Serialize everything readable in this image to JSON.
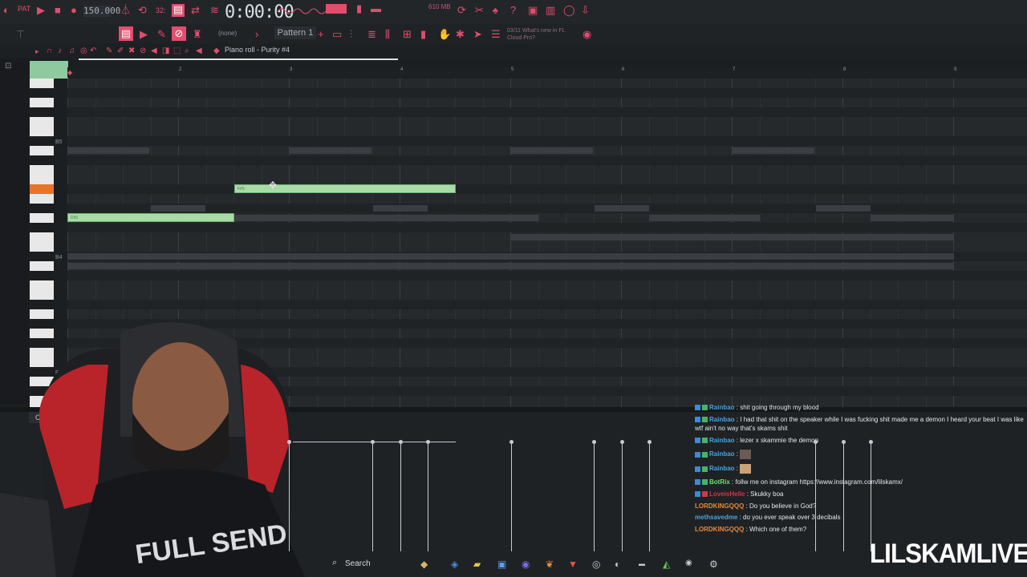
{
  "toolbar": {
    "tempo": "150.000",
    "time": "0:00:00",
    "memory": "610 MB",
    "pattern": "Pattern 1",
    "preset": "(none)",
    "hint_line1": "03/11 What's new in FL",
    "hint_line2": "Cloud Pro?",
    "accent_color": "#e24d6d"
  },
  "piano_roll": {
    "title": "Piano roll - Purity #4",
    "ruler": [
      "2",
      "3",
      "4",
      "5",
      "6",
      "7",
      "8",
      "9"
    ],
    "key_labels": [
      "B5",
      "B4",
      "B3"
    ],
    "notes": [
      {
        "label": "F#5"
      },
      {
        "label": "D#5"
      }
    ]
  },
  "event_editor": {
    "label": "Control"
  },
  "chat": [
    {
      "user": "Rainbao",
      "color": "#4aa3df",
      "text": ": shit going through my blood"
    },
    {
      "user": "Rainbao",
      "color": "#4aa3df",
      "text": ": I had that shit on the speaker while I was fucking shit made me a demon I heard your beat I was like"
    },
    {
      "user": "",
      "color": "#e6e9ec",
      "text": "wtf ain't no way that's skams shit"
    },
    {
      "user": "Rainbao",
      "color": "#4aa3df",
      "text": ": lezer x skammie the demon"
    },
    {
      "user": "Rainbao",
      "color": "#4aa3df",
      "text": ":"
    },
    {
      "user": "Rainbao",
      "color": "#4aa3df",
      "text": ":"
    },
    {
      "user": "BotRix",
      "color": "#6ee36e",
      "text": ": follw me on instagram https://www.instagram.com/lilskamx/"
    },
    {
      "user": "LoveisHelle",
      "color": "#c93a4a",
      "text": ": Skukky boa"
    },
    {
      "user": "LORDKINGQQQ",
      "color": "#e8873a",
      "text": ": Do you believe in God?"
    },
    {
      "user": "methsavedme",
      "color": "#4aa3df",
      "text": ": do you ever speak over 3 decibals"
    },
    {
      "user": "LORDKINGQQQ",
      "color": "#e8873a",
      "text": ": Which one of them?"
    }
  ],
  "taskbar": {
    "search_label": "Search"
  },
  "overlay": {
    "brand": "LILSKAMLIVE"
  }
}
